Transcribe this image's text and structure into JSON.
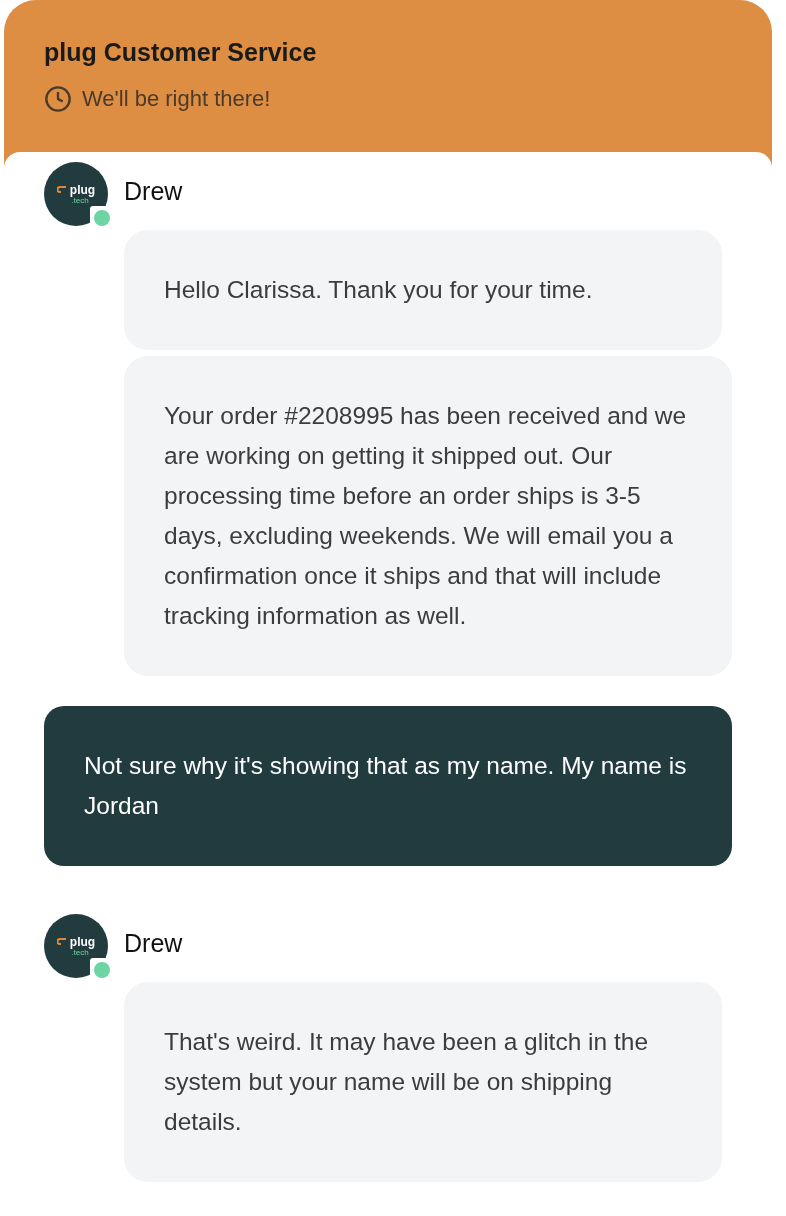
{
  "header": {
    "title": "plug Customer Service",
    "status": "We'll be right there!"
  },
  "messages": [
    {
      "kind": "agent",
      "sender": "Drew",
      "online": true,
      "logo_text": "plug",
      "logo_subtext": ".tech",
      "bubbles": [
        "Hello Clarissa. Thank you for your time.",
        "Your order #2208995 has been received and we are working on getting it shipped out. Our processing time before an order ships is 3-5 days, excluding weekends. We will email you a confirmation once it ships and that will include tracking information as well."
      ]
    },
    {
      "kind": "user",
      "bubbles": [
        "Not sure why it's showing that as my name. My name is Jordan"
      ]
    },
    {
      "kind": "agent",
      "sender": "Drew",
      "online": true,
      "logo_text": "plug",
      "logo_subtext": ".tech",
      "bubbles": [
        "That's weird. It may have been a glitch in the system but your name will be on shipping details."
      ]
    }
  ]
}
